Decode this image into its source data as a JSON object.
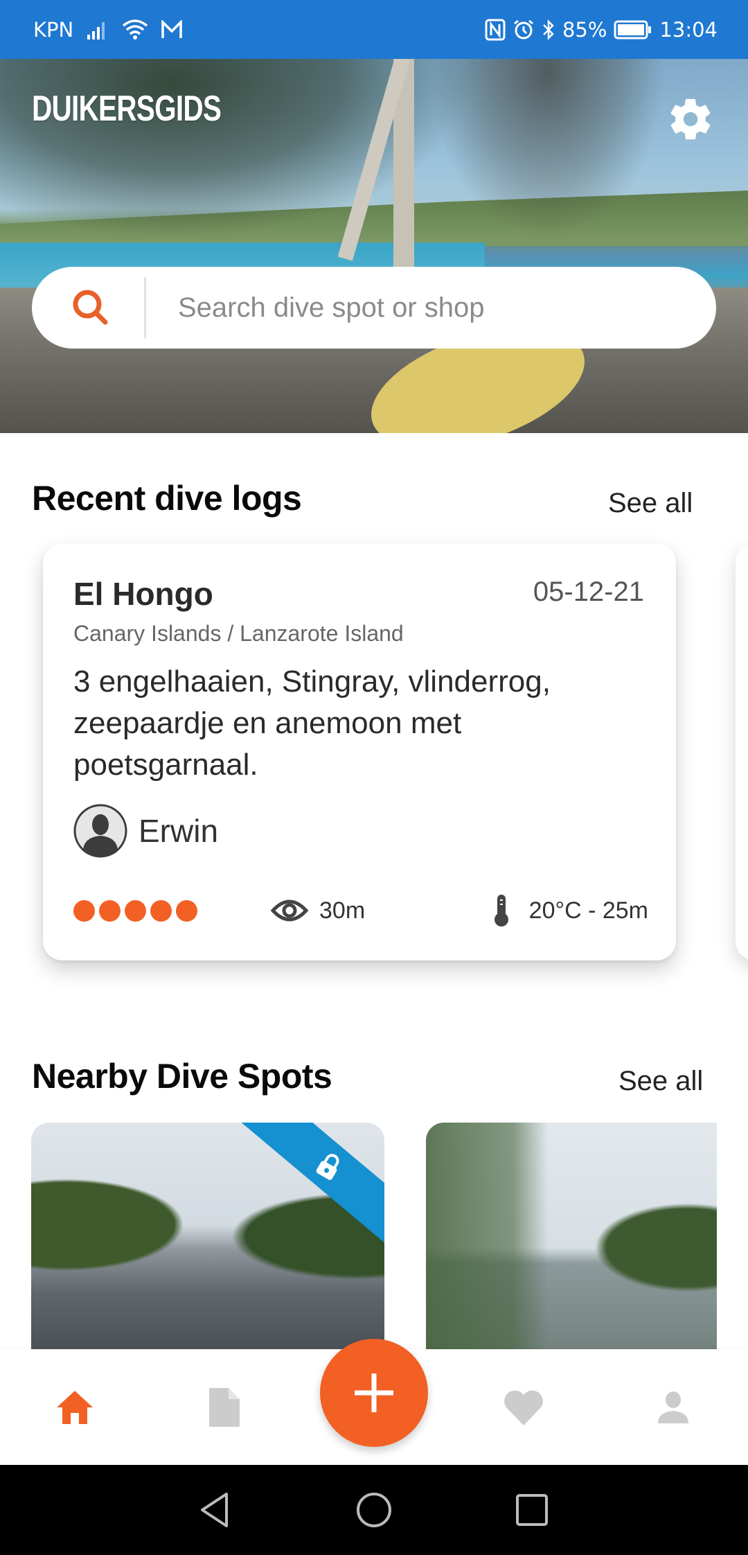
{
  "status_bar": {
    "carrier": "KPN",
    "battery": "85%",
    "time": "13:04",
    "icons": [
      "signal-icon",
      "wifi-icon",
      "gmail-icon",
      "nfc-icon",
      "alarm-icon",
      "bluetooth-icon",
      "battery-icon"
    ]
  },
  "header": {
    "app_title": "DUIKERSGIDS",
    "settings_icon": "gear-icon"
  },
  "search": {
    "placeholder": "Search dive spot or shop",
    "value": ""
  },
  "recent_logs": {
    "title": "Recent dive logs",
    "see_all": "See all",
    "items": [
      {
        "spot": "El Hongo",
        "date": "05-12-21",
        "location": "Canary Islands / Lanzarote Island",
        "description": "3 engelhaaien, Stingray, vlinderrog, zeepaardje en anemoon met poetsgarnaal.",
        "user": "Erwin",
        "rating": 5,
        "rating_max": 5,
        "visibility": "30m",
        "temperature_depth": "20°C - 25m"
      }
    ]
  },
  "nearby": {
    "title": "Nearby Dive Spots",
    "see_all": "See all",
    "spots": [
      {
        "locked": true
      },
      {
        "locked": false
      }
    ]
  },
  "bottom_nav": {
    "items": [
      {
        "name": "home",
        "icon": "home-icon",
        "active": true
      },
      {
        "name": "logs",
        "icon": "document-icon",
        "active": false
      },
      {
        "name": "add",
        "icon": "plus-icon",
        "active": false
      },
      {
        "name": "favorites",
        "icon": "heart-icon",
        "active": false
      },
      {
        "name": "profile",
        "icon": "person-icon",
        "active": false
      }
    ]
  },
  "colors": {
    "accent": "#f26024",
    "status_bar": "#1f78d1",
    "lock_ribbon": "#1590d0",
    "inactive_icon": "#cccccc"
  }
}
